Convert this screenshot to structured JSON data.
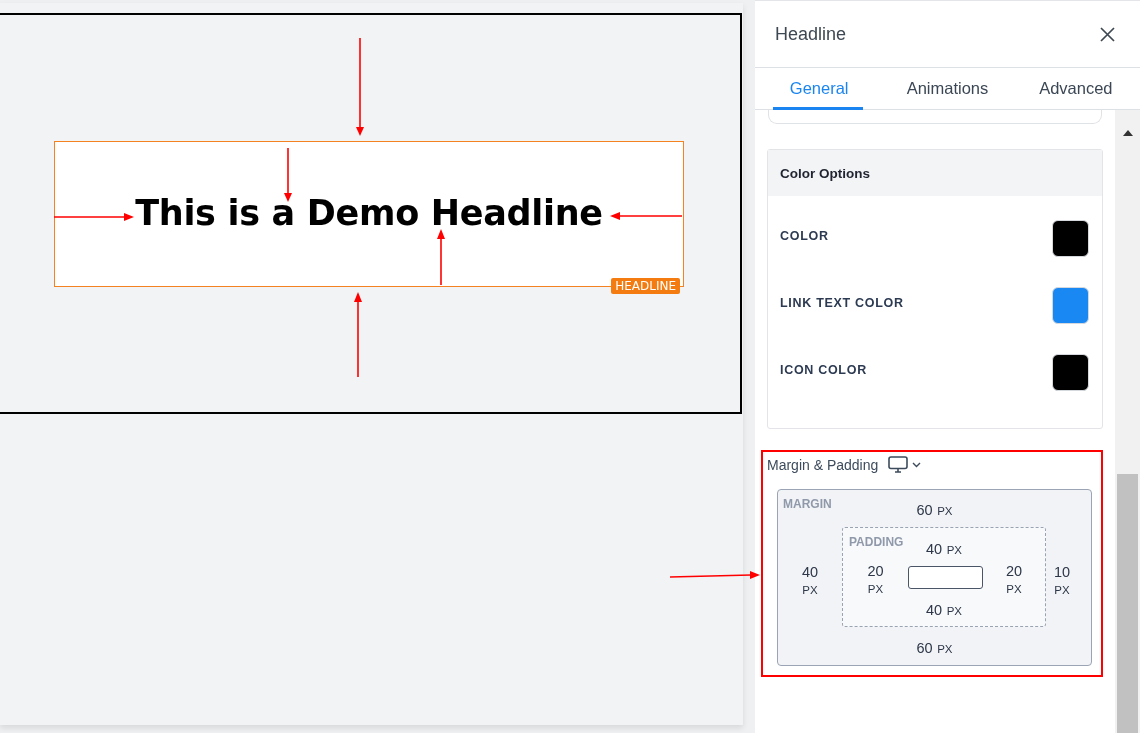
{
  "canvas": {
    "headline": {
      "text": "This is a Demo Headline",
      "badge": "HEADLINE"
    }
  },
  "panel": {
    "title": "Headline",
    "tabs": [
      {
        "label": "General",
        "selected": true
      },
      {
        "label": "Animations",
        "selected": false
      },
      {
        "label": "Advanced",
        "selected": false
      }
    ],
    "color_options": {
      "title": "Color Options",
      "items": [
        {
          "label": "COLOR",
          "color": "#000000"
        },
        {
          "label": "LINK TEXT COLOR",
          "color": "#1a88f2"
        },
        {
          "label": "ICON COLOR",
          "color": "#000000"
        }
      ]
    },
    "spacing": {
      "title": "Margin & Padding",
      "margin": {
        "label": "MARGIN",
        "top": {
          "value": "60",
          "unit": "PX"
        },
        "left": {
          "value": "40",
          "unit": "PX"
        },
        "right": {
          "value": "10",
          "unit": "PX"
        },
        "bottom": {
          "value": "60",
          "unit": "PX"
        }
      },
      "padding": {
        "label": "PADDING",
        "top": {
          "value": "40",
          "unit": "PX"
        },
        "left": {
          "value": "20",
          "unit": "PX"
        },
        "right": {
          "value": "20",
          "unit": "PX"
        },
        "bottom": {
          "value": "40",
          "unit": "PX"
        }
      }
    }
  }
}
